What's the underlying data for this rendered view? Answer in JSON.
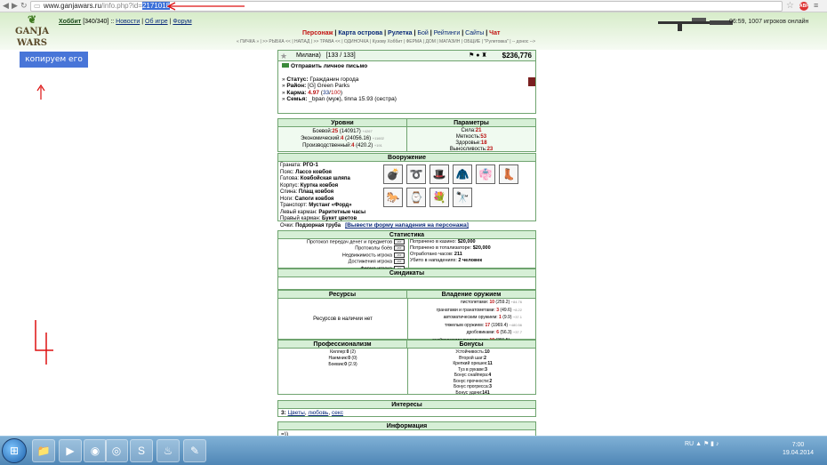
{
  "browser": {
    "url_host": "www.ganjawars.ru",
    "url_path": "/info.php?id=",
    "url_selected": "2171018"
  },
  "site": {
    "logo_top": "GANJA",
    "logo_bottom": "WARS",
    "user": {
      "nick": "Хоббит",
      "hp": "[340/340]",
      "links": [
        "Новости",
        "Об игре",
        "Форум"
      ]
    },
    "time_text": "06:59, 1007 игроков онлайн",
    "main_nav": [
      "Персонаж",
      "Карта острова",
      "Рулетка",
      "Бой",
      "Рейтинги",
      "Сайты",
      "Чат"
    ],
    "sub_nav": "« ПИЧКА » | >> РЫБКА << | НАПАД | >> ТРАВА << | ОДИНОЧКА | Кузову Хоббит | ФЕРМА | ДОМ | МАГАЗИН | ОБЩИЕ | \"Рулетовка\" | -- донос -->"
  },
  "annotation": {
    "label": "копируем его ID",
    "digit": "4"
  },
  "profile": {
    "name": "Милана)",
    "hp": "[133 / 133]",
    "money": "$236,776",
    "send_mail": "Отправить личное письмо",
    "status_k": "Статус:",
    "status_v": "Гражданин города",
    "district_k": "Район:",
    "district_v": "[G] Green Parks",
    "karma_k": "Карма:",
    "karma_v": "4.97",
    "karma_a": "33",
    "karma_b": "100",
    "family_k": "Семья:",
    "family_v": "_bpan (муж), tinna 15.93 (сестра)"
  },
  "levels": {
    "header_left": "Уровни",
    "header_right": "Параметры",
    "rows": [
      {
        "label": "Боевой:",
        "lvl": "25",
        "val": "(140917)",
        "sm": "+4267"
      },
      {
        "label": "Экономический:",
        "lvl": "4",
        "val": "(24056.16)",
        "sm": "+11602"
      },
      {
        "label": "Производственный:",
        "lvl": "4",
        "val": "(420.2)",
        "sm": "+191"
      }
    ],
    "params": [
      {
        "label": "Сила:",
        "val": "21"
      },
      {
        "label": "Меткость:",
        "val": "53"
      },
      {
        "label": "Здоровье:",
        "val": "18"
      },
      {
        "label": "Выносливость:",
        "val": "23"
      }
    ]
  },
  "equip": {
    "header": "Вооружение",
    "items": [
      {
        "slot": "Граната:",
        "name": "РГО-1"
      },
      {
        "slot": "Пояс:",
        "name": "Лассо ковбоя"
      },
      {
        "slot": "Голова:",
        "name": "Ковбойская шляпа"
      },
      {
        "slot": "Корпус:",
        "name": "Куртка ковбоя"
      },
      {
        "slot": "Спина:",
        "name": "Плащ ковбоя"
      },
      {
        "slot": "Ноги:",
        "name": "Сапоги ковбоя"
      },
      {
        "slot": "Транспорт:",
        "name": "Мустанг «Форд»"
      },
      {
        "slot": "Левый карман:",
        "name": "Раритетные часы"
      },
      {
        "slot": "Правый карман:",
        "name": "Букет цветов"
      },
      {
        "slot": "Очки:",
        "name": "Подзорная труба"
      }
    ]
  },
  "attack_link": "[Вывести форму нападения на персонажа]",
  "stats": {
    "header": "Статистика",
    "left": [
      "Протокол передач денег и предметов",
      "Протоколы боёв",
      "Недвижимость игрока",
      "Достижения игрока",
      "Ферма игрока"
    ],
    "right": [
      {
        "label": "Потрачено в казино:",
        "val": "$20,000"
      },
      {
        "label": "Потрачено в тотализаторе:",
        "val": "$20,000"
      },
      {
        "label": "Отработано часов:",
        "val": "211"
      },
      {
        "label": "Убито в нападениях:",
        "val": "2 человек"
      }
    ]
  },
  "syndicates_header": "Синдикаты",
  "resources": {
    "header_left": "Ресурсы",
    "header_right": "Владение оружием",
    "none": "Ресурсов в наличии нет",
    "weapons": [
      {
        "label": "пистолетами:",
        "lvl": "10",
        "val": "(259.2)",
        "sm": "+84.76"
      },
      {
        "label": "гранатами и гранатометами:",
        "lvl": "3",
        "val": "(49.6)",
        "sm": "+8.22"
      },
      {
        "label": "автоматическим оружием:",
        "lvl": "1",
        "val": "(9.9)",
        "sm": "+37.1"
      },
      {
        "label": "тяжелым оружием:",
        "lvl": "17",
        "val": "(1969.4)",
        "sm": "+480.56"
      },
      {
        "label": "дробовиками:",
        "lvl": "6",
        "val": "(56.3)",
        "sm": "+37.7"
      },
      {
        "label": "снайперскими винтовками:",
        "lvl": "10",
        "val": "(291.5)",
        "sm": "+31.44"
      }
    ]
  },
  "profess": {
    "header_left": "Профессионализм",
    "header_right": "Бонусы",
    "left": [
      {
        "label": "Киллер:",
        "val": "0",
        "extra": "(2)"
      },
      {
        "label": "Наемник:",
        "val": "0",
        "extra": "(0)"
      },
      {
        "label": "Боевик:",
        "val": "0",
        "extra": "(2.9)"
      }
    ],
    "bonuses": [
      {
        "label": "Устойчивость:",
        "val": "10"
      },
      {
        "label": "Второй шаг:",
        "val": "2"
      },
      {
        "label": "Крепкий орешек:",
        "val": "11"
      },
      {
        "label": "Туз в рукаве:",
        "val": "3"
      },
      {
        "label": "Бонус снайпера:",
        "val": "4"
      },
      {
        "label": "Бонус прочности:",
        "val": "2"
      },
      {
        "label": "Бонус прогресса:",
        "val": "3"
      },
      {
        "label": "Бонус удачи:",
        "val": "141"
      }
    ]
  },
  "interests": {
    "header": "Интересы",
    "prefix": "3:",
    "links": [
      "Цветы",
      "любовь",
      "секс"
    ]
  },
  "information": {
    "header": "Информация",
    "text": "=))"
  },
  "taskbar": {
    "lang": "RU",
    "time": "7:00",
    "date": "19.04.2014"
  }
}
